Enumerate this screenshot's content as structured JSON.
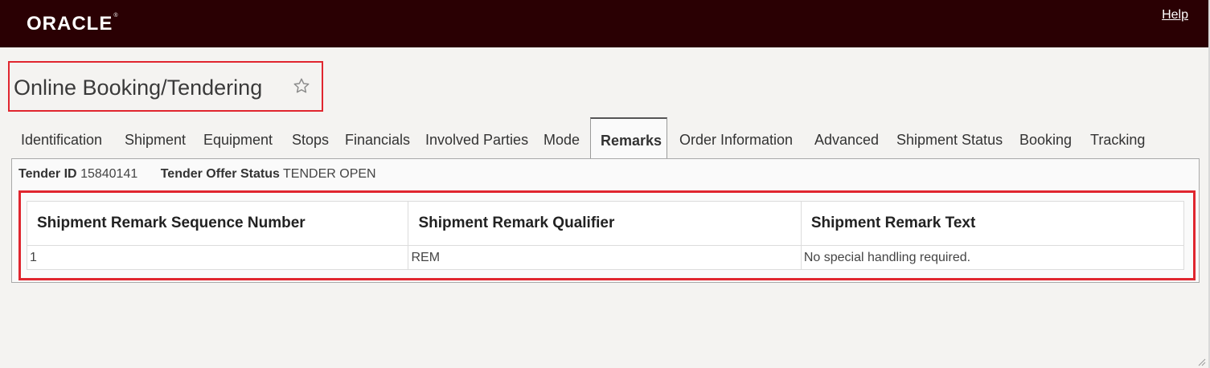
{
  "header": {
    "logo": "ORACLE",
    "help_link": "Help"
  },
  "page": {
    "title": "Online Booking/Tendering"
  },
  "tabs": [
    {
      "label": "Identification"
    },
    {
      "label": "Shipment"
    },
    {
      "label": "Equipment"
    },
    {
      "label": "Stops"
    },
    {
      "label": "Financials"
    },
    {
      "label": "Involved Parties"
    },
    {
      "label": "Mode"
    },
    {
      "label": "Remarks",
      "active": true
    },
    {
      "label": "Order Information"
    },
    {
      "label": "Advanced"
    },
    {
      "label": "Shipment Status"
    },
    {
      "label": "Booking"
    },
    {
      "label": "Tracking"
    }
  ],
  "info": {
    "tender_id_label": "Tender ID",
    "tender_id_value": "15840141",
    "status_label": "Tender Offer Status",
    "status_value": "TENDER OPEN"
  },
  "table": {
    "columns": [
      "Shipment Remark Sequence Number",
      "Shipment Remark Qualifier",
      "Shipment Remark Text"
    ],
    "rows": [
      [
        "1",
        "REM",
        "No special handling required."
      ]
    ]
  },
  "colors": {
    "header_bg": "#2a0003",
    "highlight": "#e0262f",
    "page_bg": "#f4f3f1"
  }
}
